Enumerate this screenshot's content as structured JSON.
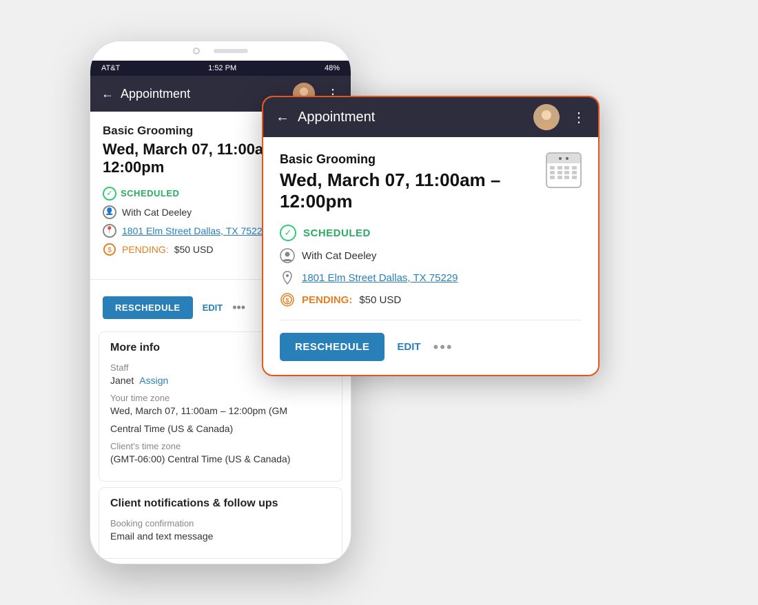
{
  "back_phone": {
    "status_bar": {
      "carrier": "AT&T",
      "time": "1:52 PM",
      "battery": "48%"
    },
    "header": {
      "back_arrow": "←",
      "title": "Appointment",
      "more_dots": "⋮"
    },
    "appointment": {
      "service": "Basic Grooming",
      "datetime": "Wed, March 07, 11:00am – 12:00pm",
      "status": "SCHEDULED",
      "with_label": "With Cat Deeley",
      "address": "1801 Elm Street Dallas, TX 75229",
      "pending_label": "PENDING:",
      "pending_amount": "$50 USD"
    },
    "buttons": {
      "reschedule": "RESCHEDULE",
      "edit": "EDIT"
    },
    "more_info": {
      "title": "More info",
      "staff_label": "Staff",
      "staff_name": "Janet",
      "assign_link": "Assign",
      "timezone_label": "Your time zone",
      "timezone_value": "Wed, March 07, 11:00am – 12:00pm (GM",
      "timezone_sub": "Central Time (US & Canada)",
      "client_tz_label": "Client's time zone",
      "client_tz_value": "(GMT-06:00) Central Time (US & Canada)"
    },
    "notifications": {
      "title": "Client notifications & follow ups",
      "booking_label": "Booking confirmation",
      "booking_value": "Email and text message"
    }
  },
  "front_card": {
    "header": {
      "back_arrow": "←",
      "title": "Appointment",
      "more_dots": "⋮"
    },
    "appointment": {
      "service": "Basic Grooming",
      "datetime": "Wed, March 07, 11:00am – 12:00pm",
      "status": "SCHEDULED",
      "with_label": "With Cat Deeley",
      "address": "1801 Elm Street Dallas, TX 75229",
      "pending_label": "PENDING:",
      "pending_amount": "$50 USD"
    },
    "buttons": {
      "reschedule": "RESCHEDULE",
      "edit": "EDIT",
      "more": "•••"
    }
  }
}
